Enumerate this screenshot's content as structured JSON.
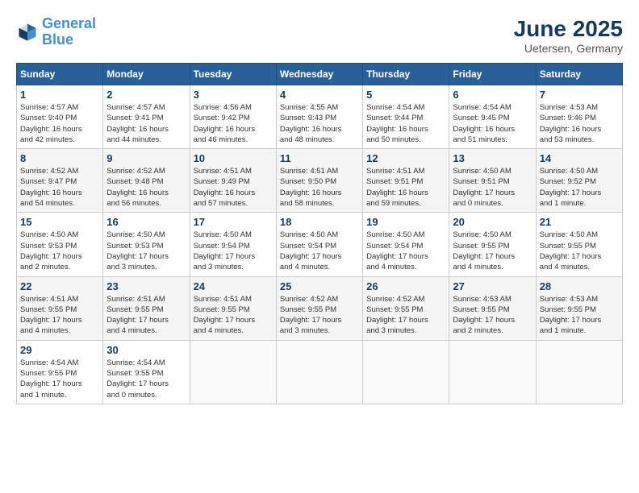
{
  "header": {
    "logo_line1": "General",
    "logo_line2": "Blue",
    "month_title": "June 2025",
    "location": "Uetersen, Germany"
  },
  "weekdays": [
    "Sunday",
    "Monday",
    "Tuesday",
    "Wednesday",
    "Thursday",
    "Friday",
    "Saturday"
  ],
  "weeks": [
    [
      {
        "day": "1",
        "info": "Sunrise: 4:57 AM\nSunset: 9:40 PM\nDaylight: 16 hours\nand 42 minutes."
      },
      {
        "day": "2",
        "info": "Sunrise: 4:57 AM\nSunset: 9:41 PM\nDaylight: 16 hours\nand 44 minutes."
      },
      {
        "day": "3",
        "info": "Sunrise: 4:56 AM\nSunset: 9:42 PM\nDaylight: 16 hours\nand 46 minutes."
      },
      {
        "day": "4",
        "info": "Sunrise: 4:55 AM\nSunset: 9:43 PM\nDaylight: 16 hours\nand 48 minutes."
      },
      {
        "day": "5",
        "info": "Sunrise: 4:54 AM\nSunset: 9:44 PM\nDaylight: 16 hours\nand 50 minutes."
      },
      {
        "day": "6",
        "info": "Sunrise: 4:54 AM\nSunset: 9:45 PM\nDaylight: 16 hours\nand 51 minutes."
      },
      {
        "day": "7",
        "info": "Sunrise: 4:53 AM\nSunset: 9:46 PM\nDaylight: 16 hours\nand 53 minutes."
      }
    ],
    [
      {
        "day": "8",
        "info": "Sunrise: 4:52 AM\nSunset: 9:47 PM\nDaylight: 16 hours\nand 54 minutes."
      },
      {
        "day": "9",
        "info": "Sunrise: 4:52 AM\nSunset: 9:48 PM\nDaylight: 16 hours\nand 56 minutes."
      },
      {
        "day": "10",
        "info": "Sunrise: 4:51 AM\nSunset: 9:49 PM\nDaylight: 16 hours\nand 57 minutes."
      },
      {
        "day": "11",
        "info": "Sunrise: 4:51 AM\nSunset: 9:50 PM\nDaylight: 16 hours\nand 58 minutes."
      },
      {
        "day": "12",
        "info": "Sunrise: 4:51 AM\nSunset: 9:51 PM\nDaylight: 16 hours\nand 59 minutes."
      },
      {
        "day": "13",
        "info": "Sunrise: 4:50 AM\nSunset: 9:51 PM\nDaylight: 17 hours\nand 0 minutes."
      },
      {
        "day": "14",
        "info": "Sunrise: 4:50 AM\nSunset: 9:52 PM\nDaylight: 17 hours\nand 1 minute."
      }
    ],
    [
      {
        "day": "15",
        "info": "Sunrise: 4:50 AM\nSunset: 9:53 PM\nDaylight: 17 hours\nand 2 minutes."
      },
      {
        "day": "16",
        "info": "Sunrise: 4:50 AM\nSunset: 9:53 PM\nDaylight: 17 hours\nand 3 minutes."
      },
      {
        "day": "17",
        "info": "Sunrise: 4:50 AM\nSunset: 9:54 PM\nDaylight: 17 hours\nand 3 minutes."
      },
      {
        "day": "18",
        "info": "Sunrise: 4:50 AM\nSunset: 9:54 PM\nDaylight: 17 hours\nand 4 minutes."
      },
      {
        "day": "19",
        "info": "Sunrise: 4:50 AM\nSunset: 9:54 PM\nDaylight: 17 hours\nand 4 minutes."
      },
      {
        "day": "20",
        "info": "Sunrise: 4:50 AM\nSunset: 9:55 PM\nDaylight: 17 hours\nand 4 minutes."
      },
      {
        "day": "21",
        "info": "Sunrise: 4:50 AM\nSunset: 9:55 PM\nDaylight: 17 hours\nand 4 minutes."
      }
    ],
    [
      {
        "day": "22",
        "info": "Sunrise: 4:51 AM\nSunset: 9:55 PM\nDaylight: 17 hours\nand 4 minutes."
      },
      {
        "day": "23",
        "info": "Sunrise: 4:51 AM\nSunset: 9:55 PM\nDaylight: 17 hours\nand 4 minutes."
      },
      {
        "day": "24",
        "info": "Sunrise: 4:51 AM\nSunset: 9:55 PM\nDaylight: 17 hours\nand 4 minutes."
      },
      {
        "day": "25",
        "info": "Sunrise: 4:52 AM\nSunset: 9:55 PM\nDaylight: 17 hours\nand 3 minutes."
      },
      {
        "day": "26",
        "info": "Sunrise: 4:52 AM\nSunset: 9:55 PM\nDaylight: 17 hours\nand 3 minutes."
      },
      {
        "day": "27",
        "info": "Sunrise: 4:53 AM\nSunset: 9:55 PM\nDaylight: 17 hours\nand 2 minutes."
      },
      {
        "day": "28",
        "info": "Sunrise: 4:53 AM\nSunset: 9:55 PM\nDaylight: 17 hours\nand 1 minute."
      }
    ],
    [
      {
        "day": "29",
        "info": "Sunrise: 4:54 AM\nSunset: 9:55 PM\nDaylight: 17 hours\nand 1 minute."
      },
      {
        "day": "30",
        "info": "Sunrise: 4:54 AM\nSunset: 9:55 PM\nDaylight: 17 hours\nand 0 minutes."
      },
      {
        "day": "",
        "info": ""
      },
      {
        "day": "",
        "info": ""
      },
      {
        "day": "",
        "info": ""
      },
      {
        "day": "",
        "info": ""
      },
      {
        "day": "",
        "info": ""
      }
    ]
  ]
}
